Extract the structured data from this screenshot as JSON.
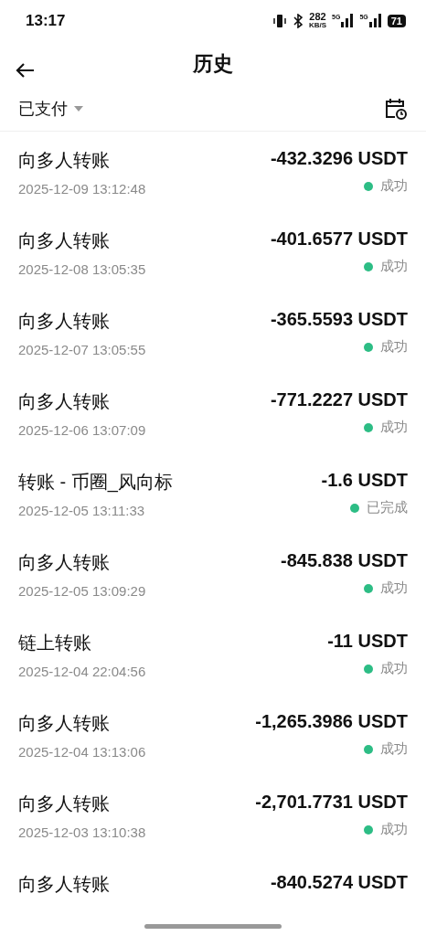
{
  "status_bar": {
    "time": "13:17",
    "speed": "282",
    "speed_unit": "KB/S",
    "network_1": "5G",
    "network_2": "5G",
    "battery": "71"
  },
  "header": {
    "title": "历史"
  },
  "filter": {
    "label": "已支付"
  },
  "transactions": [
    {
      "title": "向多人转账",
      "time": "2025-12-09 13:12:48",
      "amount": "-432.3296 USDT",
      "status": "成功"
    },
    {
      "title": "向多人转账",
      "time": "2025-12-08 13:05:35",
      "amount": "-401.6577 USDT",
      "status": "成功"
    },
    {
      "title": "向多人转账",
      "time": "2025-12-07 13:05:55",
      "amount": "-365.5593 USDT",
      "status": "成功"
    },
    {
      "title": "向多人转账",
      "time": "2025-12-06 13:07:09",
      "amount": "-771.2227 USDT",
      "status": "成功"
    },
    {
      "title": "转账 - 币圈_风向标",
      "time": "2025-12-05 13:11:33",
      "amount": "-1.6 USDT",
      "status": "已完成"
    },
    {
      "title": "向多人转账",
      "time": "2025-12-05 13:09:29",
      "amount": "-845.838 USDT",
      "status": "成功"
    },
    {
      "title": "链上转账",
      "time": "2025-12-04 22:04:56",
      "amount": "-11 USDT",
      "status": "成功"
    },
    {
      "title": "向多人转账",
      "time": "2025-12-04 13:13:06",
      "amount": "-1,265.3986 USDT",
      "status": "成功"
    },
    {
      "title": "向多人转账",
      "time": "2025-12-03 13:10:38",
      "amount": "-2,701.7731 USDT",
      "status": "成功"
    },
    {
      "title": "向多人转账",
      "amount": "-840.5274 USDT"
    }
  ]
}
